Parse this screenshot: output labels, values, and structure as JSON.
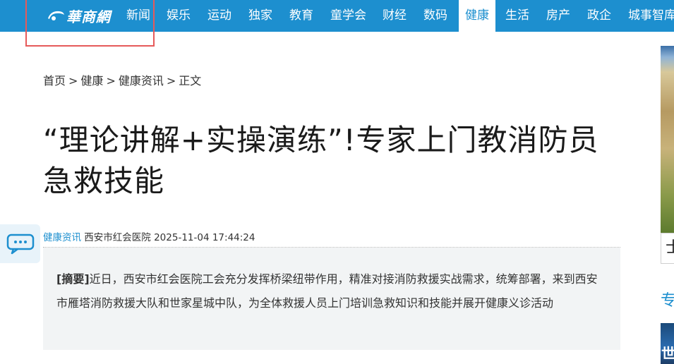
{
  "brand": {
    "logo_text": "華商網"
  },
  "nav": {
    "items": [
      {
        "label": "新闻",
        "active": false
      },
      {
        "label": "娱乐",
        "active": false
      },
      {
        "label": "运动",
        "active": false
      },
      {
        "label": "独家",
        "active": false
      },
      {
        "label": "教育",
        "active": false
      },
      {
        "label": "童学会",
        "active": false
      },
      {
        "label": "财经",
        "active": false
      },
      {
        "label": "数码",
        "active": false
      },
      {
        "label": "健康",
        "active": true
      },
      {
        "label": "生活",
        "active": false
      },
      {
        "label": "房产",
        "active": false
      },
      {
        "label": "政企",
        "active": false
      },
      {
        "label": "城事智库",
        "active": false
      }
    ]
  },
  "breadcrumb": {
    "home": "首页",
    "section": "健康",
    "subsection": "健康资讯",
    "current": "正文",
    "separator": ">"
  },
  "article": {
    "title": "“理论讲解+实操演练”!专家上门教消防员急救技能",
    "category": "健康资讯",
    "source": "西安市红会医院",
    "datetime": "2025-11-04 17:44:24",
    "abstract_label": "[摘要]",
    "abstract_text": "近日，西安市红会医院工会充分发挥桥梁纽带作用，精准对接消防救援实战需求，统筹部署，来到西安市雁塔消防救援大队和世家星城中队，为全体救援人员上门培训急救知识和技能并展开健康义诊活动"
  },
  "sidebar": {
    "box_glyph": "士",
    "section_head": "专",
    "promo_glyph": "世"
  },
  "floating": {
    "icon": "chat-bubble-icon"
  },
  "colors": {
    "nav_bg": "#1d8fcf",
    "accent": "#1d8fcf",
    "highlight_border": "#e65a5a",
    "abstract_bg": "#f2f4f5"
  }
}
